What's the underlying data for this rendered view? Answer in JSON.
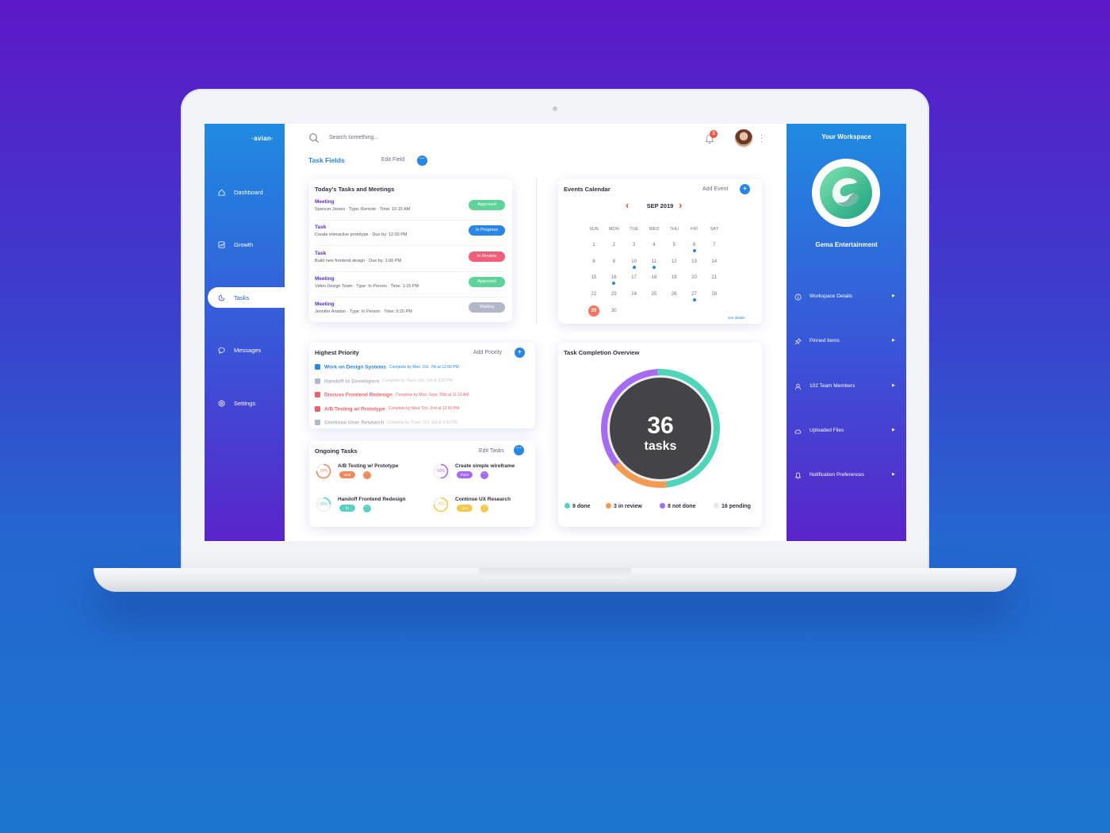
{
  "app": {
    "brand": "·avian·"
  },
  "sidebar": {
    "items": [
      {
        "label": "Dashboard",
        "icon": "home-icon"
      },
      {
        "label": "Growth",
        "icon": "chart-icon"
      },
      {
        "label": "Tasks",
        "icon": "tasks-icon",
        "active": true
      },
      {
        "label": "Messages",
        "icon": "chat-icon"
      },
      {
        "label": "Settings",
        "icon": "gear-icon"
      }
    ]
  },
  "header": {
    "search_placeholder": "Search something...",
    "notification_count": "3"
  },
  "toolbar": {
    "title": "Task Fields",
    "edit_field": "Edit Field"
  },
  "today": {
    "title": "Today's Tasks and Meetings",
    "items": [
      {
        "title": "Meeting",
        "desc": "Spencer James · Type: Remote · Time: 10:15 AM",
        "status": "Approved",
        "color": "#5fd39a"
      },
      {
        "title": "Task",
        "desc": "Create interactive prototype · Due by: 12:00 PM",
        "status": "In Progress",
        "color": "#2a86e6"
      },
      {
        "title": "Task",
        "desc": "Build new frontend design · Due by: 1:00 PM",
        "status": "In Review",
        "color": "#ef5f7a"
      },
      {
        "title": "Meeting",
        "desc": "Video Design Team · Type: In Person · Time: 1:15 PM",
        "status": "Approved",
        "color": "#5fd39a"
      },
      {
        "title": "Meeting",
        "desc": "Jennifer Aniston · Type: In Person · Time: 3:20 PM",
        "status": "Waiting",
        "color": "#b3b8c8"
      }
    ]
  },
  "calendar": {
    "title": "Events Calendar",
    "add_event": "Add Event",
    "month": "SEP 2019",
    "days_of_week": [
      "SUN",
      "MON",
      "TUE",
      "WED",
      "THU",
      "FRI",
      "SAT"
    ],
    "days": [
      "1",
      "2",
      "3",
      "4",
      "5",
      "6",
      "7",
      "8",
      "9",
      "10",
      "11",
      "12",
      "13",
      "14",
      "15",
      "16",
      "17",
      "18",
      "19",
      "20",
      "21",
      "22",
      "23",
      "24",
      "25",
      "26",
      "27",
      "28",
      "29",
      "30"
    ],
    "event_days": [
      "6",
      "10",
      "11",
      "16",
      "27"
    ],
    "today": "29",
    "see_details": "see details"
  },
  "priority": {
    "title": "Highest Priority",
    "add_label": "Add Priority",
    "items": [
      {
        "name": "Work on Design Systems",
        "due": "Complete by Mon. Oct. 7th at 12:00 PM",
        "color": "#2a86e6"
      },
      {
        "name": "Handoff to Developers",
        "due": "Complete by Thurs. Oct. 3rd at 3:20 PM",
        "color": "#b3b8c8"
      },
      {
        "name": "Discuss Frontend Redesign",
        "due": "Complete by Mon. Sept. 30th at 11:10 AM",
        "color": "#ef5f6a"
      },
      {
        "name": "A/B Testing w/ Prototype",
        "due": "Complete by Wed. Oct. 2nd at 12:00 PM",
        "color": "#ef5f6a"
      },
      {
        "name": "Continue User Research",
        "due": "Complete by Thurs. Oct. 3rd at 3:30 PM",
        "color": "#b3b8c8"
      }
    ]
  },
  "ongoing": {
    "title": "Ongoing Tasks",
    "edit_label": "Edit Tasks",
    "items": [
      {
        "name": "A/B Testing w/ Prototype",
        "progress": 75,
        "pct_label": "75%",
        "tag": "wed",
        "color": "#f08a5d"
      },
      {
        "name": "Create simple wireframe",
        "progress": 50,
        "pct_label": "50%",
        "tag": "thurs",
        "color": "#a66bf0"
      },
      {
        "name": "Handoff Frontend Redesign",
        "progress": 25,
        "pct_label": "25%",
        "tag": "fri",
        "color": "#5ccfc3"
      },
      {
        "name": "Continue UX Research",
        "progress": 75,
        "pct_label": "75%",
        "tag": "tue",
        "color": "#f6c94e"
      }
    ]
  },
  "completion": {
    "title": "Task Completion Overview",
    "total": "36",
    "unit": "tasks"
  },
  "chart_data": {
    "type": "pie",
    "categories": [
      "done",
      "in review",
      "not done",
      "pending"
    ],
    "values": [
      9,
      3,
      8,
      16
    ],
    "legend": [
      "9 done",
      "3 in review",
      "8 not done",
      "16 pending"
    ],
    "colors": [
      "#4fd6b8",
      "#f49a52",
      "#a66bf0",
      "#e9eaee"
    ]
  },
  "workspace": {
    "title": "Your Workspace",
    "name": "Gema Entertainment",
    "items": [
      {
        "label": "Workspace Details",
        "icon": "info-icon"
      },
      {
        "label": "Pinned Items",
        "icon": "pin-icon"
      },
      {
        "label": "102 Team Members",
        "icon": "user-icon"
      },
      {
        "label": "Uploaded Files",
        "icon": "cloud-icon"
      },
      {
        "label": "Notification Preferences",
        "icon": "bell-icon"
      }
    ]
  }
}
